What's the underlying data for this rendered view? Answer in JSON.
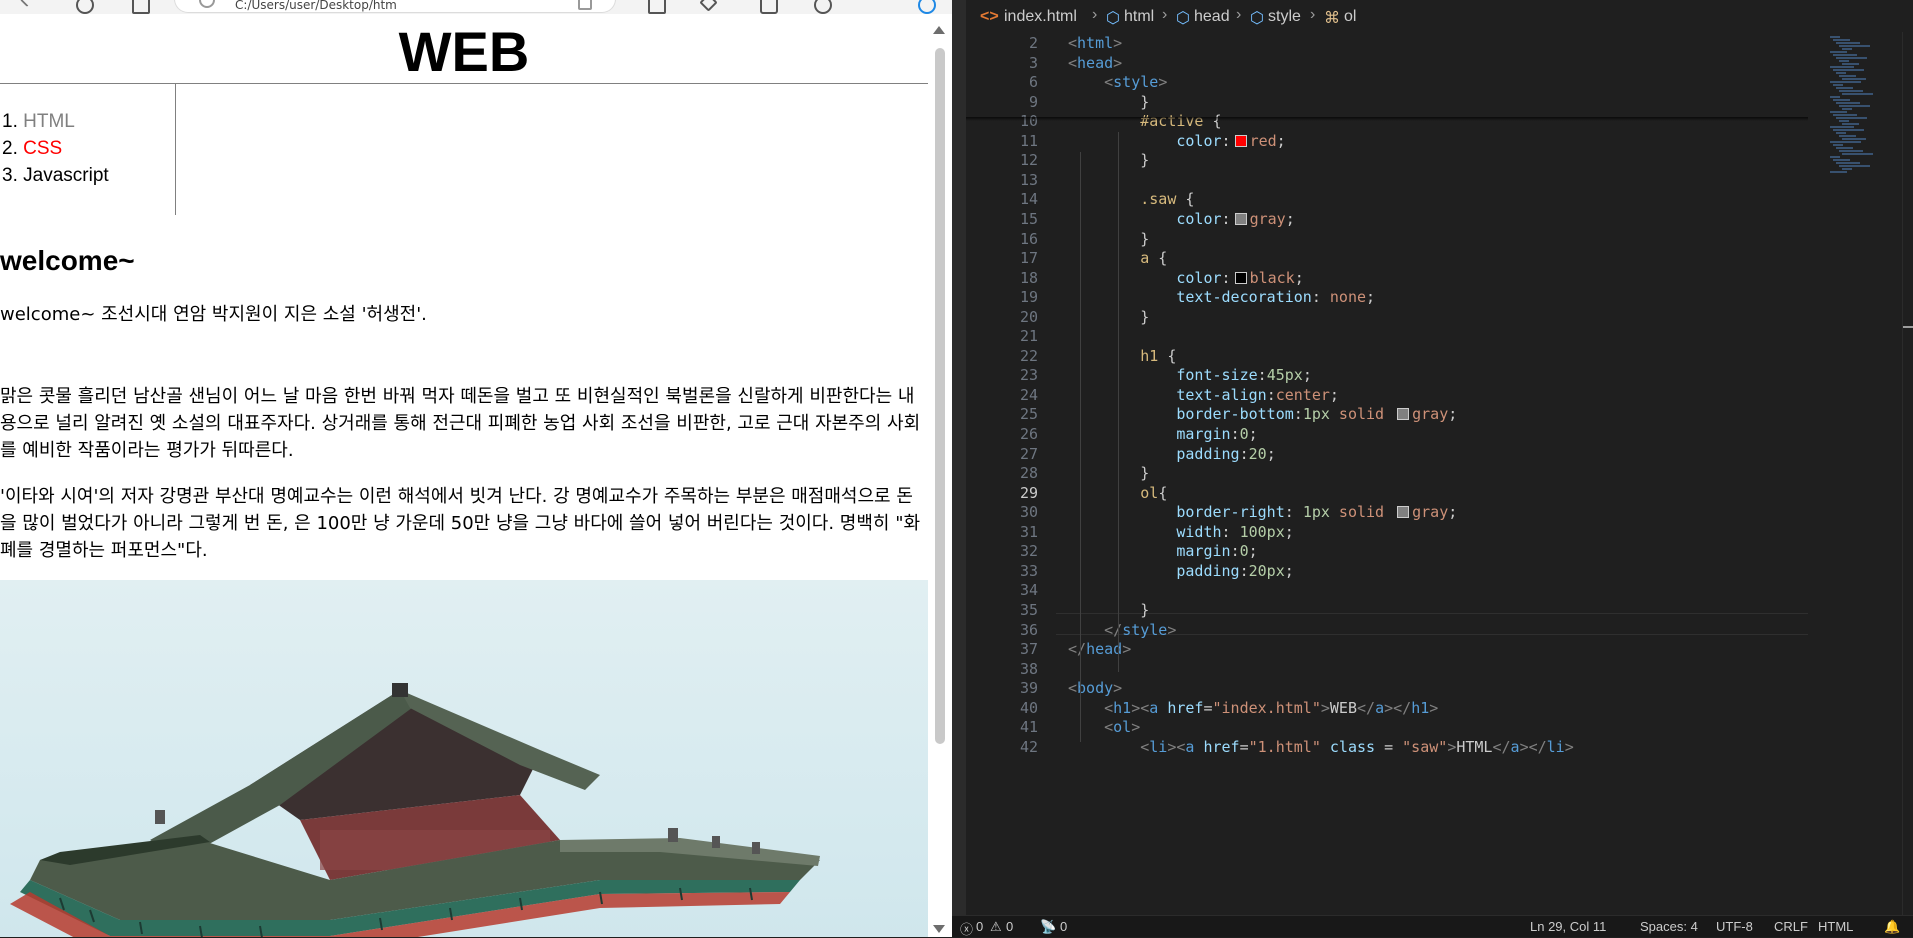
{
  "browser": {
    "address_text": "C:/Users/user/Desktop/htm",
    "page": {
      "title": "WEB",
      "nav": [
        {
          "num": "1.",
          "label": "HTML",
          "color": "#808080"
        },
        {
          "num": "2.",
          "label": "CSS",
          "color": "#ff0000"
        },
        {
          "num": "3.",
          "label": "Javascript",
          "color": "#000000"
        }
      ],
      "heading": "welcome~",
      "paragraphs": [
        "welcome~ 조선시대 연암 박지원이 지은 소설 '허생전'.",
        "맑은 콧물 흘리던 남산골 샌님이 어느 날 마음 한번 바꿔 먹자 떼돈을 벌고 또 비현실적인 북벌론을 신랄하게 비판한다는 내용으로 널리 알려진 옛 소설의 대표주자다. 상거래를 통해 전근대 피폐한 농업 사회 조선을 비판한, 고로 근대 자본주의 사회를 예비한 작품이라는 평가가 뒤따른다.",
        "'이타와 시여'의 저자 강명관 부산대 명예교수는 이런 해석에서 빗겨 난다. 강 명예교수가 주목하는 부분은 매점매석으로 돈을 많이 벌었다가 아니라 그렇게 번 돈, 은 100만 냥 가운데 50만 냥을 그냥 바다에 쓸어 넣어 버린다는 것이다. 명백히 \"화폐를 경멸하는 퍼포먼스\"다."
      ],
      "image_desc": "palace-roof-photo"
    }
  },
  "editor": {
    "breadcrumb": [
      "index.html",
      "html",
      "head",
      "style",
      "ol"
    ],
    "lines": [
      {
        "n": "2",
        "tokens": [
          [
            "tagbr",
            "<"
          ],
          [
            "tag",
            "html"
          ],
          [
            "tagbr",
            ">"
          ]
        ]
      },
      {
        "n": "3",
        "tokens": [
          [
            "tagbr",
            "<"
          ],
          [
            "tag",
            "head"
          ],
          [
            "tagbr",
            ">"
          ]
        ]
      },
      {
        "n": "6",
        "tokens": [
          [
            "punct",
            "    "
          ],
          [
            "tagbr",
            "<"
          ],
          [
            "tag",
            "style"
          ],
          [
            "tagbr",
            ">"
          ]
        ]
      },
      {
        "n": "9",
        "tokens": [
          [
            "punct",
            "        }"
          ]
        ]
      },
      {
        "n": "10",
        "tokens": [
          [
            "punct",
            "        "
          ],
          [
            "sel",
            "#active"
          ],
          [
            "punct",
            " {"
          ]
        ]
      },
      {
        "n": "11",
        "tokens": [
          [
            "punct",
            "            "
          ],
          [
            "prop",
            "color"
          ],
          [
            "punct",
            ":"
          ],
          [
            "sw:#ff0000",
            ""
          ],
          [
            "val",
            "red"
          ],
          [
            "punct",
            ";"
          ]
        ]
      },
      {
        "n": "12",
        "tokens": [
          [
            "punct",
            "        }"
          ]
        ]
      },
      {
        "n": "13",
        "tokens": []
      },
      {
        "n": "14",
        "tokens": [
          [
            "punct",
            "        "
          ],
          [
            "sel",
            ".saw"
          ],
          [
            "punct",
            " {"
          ]
        ]
      },
      {
        "n": "15",
        "tokens": [
          [
            "punct",
            "            "
          ],
          [
            "prop",
            "color"
          ],
          [
            "punct",
            ":"
          ],
          [
            "sw:#808080",
            ""
          ],
          [
            "val",
            "gray"
          ],
          [
            "punct",
            ";"
          ]
        ]
      },
      {
        "n": "16",
        "tokens": [
          [
            "punct",
            "        }"
          ]
        ]
      },
      {
        "n": "17",
        "tokens": [
          [
            "punct",
            "        "
          ],
          [
            "sel",
            "a"
          ],
          [
            "punct",
            " {"
          ]
        ]
      },
      {
        "n": "18",
        "tokens": [
          [
            "punct",
            "            "
          ],
          [
            "prop",
            "color"
          ],
          [
            "punct",
            ":"
          ],
          [
            "sw:#000000",
            ""
          ],
          [
            "val",
            "black"
          ],
          [
            "punct",
            ";"
          ]
        ]
      },
      {
        "n": "19",
        "tokens": [
          [
            "punct",
            "            "
          ],
          [
            "prop",
            "text-decoration"
          ],
          [
            "punct",
            ": "
          ],
          [
            "val",
            "none"
          ],
          [
            "punct",
            ";"
          ]
        ]
      },
      {
        "n": "20",
        "tokens": [
          [
            "punct",
            "        }"
          ]
        ]
      },
      {
        "n": "21",
        "tokens": []
      },
      {
        "n": "22",
        "tokens": [
          [
            "punct",
            "        "
          ],
          [
            "sel",
            "h1"
          ],
          [
            "punct",
            " {"
          ]
        ]
      },
      {
        "n": "23",
        "tokens": [
          [
            "punct",
            "            "
          ],
          [
            "prop",
            "font-size"
          ],
          [
            "punct",
            ":"
          ],
          [
            "num",
            "45px"
          ],
          [
            "punct",
            ";"
          ]
        ]
      },
      {
        "n": "24",
        "tokens": [
          [
            "punct",
            "            "
          ],
          [
            "prop",
            "text-align"
          ],
          [
            "punct",
            ":"
          ],
          [
            "val",
            "center"
          ],
          [
            "punct",
            ";"
          ]
        ]
      },
      {
        "n": "25",
        "tokens": [
          [
            "punct",
            "            "
          ],
          [
            "prop",
            "border-bottom"
          ],
          [
            "punct",
            ":"
          ],
          [
            "num",
            "1px"
          ],
          [
            "val",
            " solid "
          ],
          [
            "sw:#808080",
            ""
          ],
          [
            "val",
            "gray"
          ],
          [
            "punct",
            ";"
          ]
        ]
      },
      {
        "n": "26",
        "tokens": [
          [
            "punct",
            "            "
          ],
          [
            "prop",
            "margin"
          ],
          [
            "punct",
            ":"
          ],
          [
            "num",
            "0"
          ],
          [
            "punct",
            ";"
          ]
        ]
      },
      {
        "n": "27",
        "tokens": [
          [
            "punct",
            "            "
          ],
          [
            "prop",
            "padding"
          ],
          [
            "punct",
            ":"
          ],
          [
            "num",
            "20"
          ],
          [
            "punct",
            ";"
          ]
        ]
      },
      {
        "n": "28",
        "tokens": [
          [
            "punct",
            "        }"
          ]
        ]
      },
      {
        "n": "29",
        "tokens": [
          [
            "punct",
            "        "
          ],
          [
            "sel",
            "ol"
          ],
          [
            "punct",
            "{"
          ]
        ]
      },
      {
        "n": "30",
        "tokens": [
          [
            "punct",
            "            "
          ],
          [
            "prop",
            "border-right"
          ],
          [
            "punct",
            ": "
          ],
          [
            "num",
            "1px"
          ],
          [
            "val",
            " solid "
          ],
          [
            "sw:#808080",
            ""
          ],
          [
            "val",
            "gray"
          ],
          [
            "punct",
            ";"
          ]
        ]
      },
      {
        "n": "31",
        "tokens": [
          [
            "punct",
            "            "
          ],
          [
            "prop",
            "width"
          ],
          [
            "punct",
            ": "
          ],
          [
            "num",
            "100px"
          ],
          [
            "punct",
            ";"
          ]
        ]
      },
      {
        "n": "32",
        "tokens": [
          [
            "punct",
            "            "
          ],
          [
            "prop",
            "margin"
          ],
          [
            "punct",
            ":"
          ],
          [
            "num",
            "0"
          ],
          [
            "punct",
            ";"
          ]
        ]
      },
      {
        "n": "33",
        "tokens": [
          [
            "punct",
            "            "
          ],
          [
            "prop",
            "padding"
          ],
          [
            "punct",
            ":"
          ],
          [
            "num",
            "20px"
          ],
          [
            "punct",
            ";"
          ]
        ]
      },
      {
        "n": "34",
        "tokens": []
      },
      {
        "n": "35",
        "tokens": [
          [
            "punct",
            "        }"
          ]
        ]
      },
      {
        "n": "36",
        "tokens": [
          [
            "punct",
            "    "
          ],
          [
            "tagbr",
            "</"
          ],
          [
            "tag",
            "style"
          ],
          [
            "tagbr",
            ">"
          ]
        ]
      },
      {
        "n": "37",
        "tokens": [
          [
            "tagbr",
            "</"
          ],
          [
            "tag",
            "head"
          ],
          [
            "tagbr",
            ">"
          ]
        ]
      },
      {
        "n": "38",
        "tokens": []
      },
      {
        "n": "39",
        "tokens": [
          [
            "tagbr",
            "<"
          ],
          [
            "tag",
            "body"
          ],
          [
            "tagbr",
            ">"
          ]
        ]
      },
      {
        "n": "40",
        "tokens": [
          [
            "punct",
            "    "
          ],
          [
            "tagbr",
            "<"
          ],
          [
            "tag",
            "h1"
          ],
          [
            "tagbr",
            "><"
          ],
          [
            "tag",
            "a"
          ],
          [
            "punct",
            " "
          ],
          [
            "attr",
            "href"
          ],
          [
            "punct",
            "="
          ],
          [
            "str",
            "\"index.html\""
          ],
          [
            "tagbr",
            ">"
          ],
          [
            "punct",
            "WEB"
          ],
          [
            "tagbr",
            "</"
          ],
          [
            "tag",
            "a"
          ],
          [
            "tagbr",
            "></"
          ],
          [
            "tag",
            "h1"
          ],
          [
            "tagbr",
            ">"
          ]
        ]
      },
      {
        "n": "41",
        "tokens": [
          [
            "punct",
            "    "
          ],
          [
            "tagbr",
            "<"
          ],
          [
            "tag",
            "ol"
          ],
          [
            "tagbr",
            ">"
          ]
        ]
      },
      {
        "n": "42",
        "tokens": [
          [
            "punct",
            "        "
          ],
          [
            "tagbr",
            "<"
          ],
          [
            "tag",
            "li"
          ],
          [
            "tagbr",
            "><"
          ],
          [
            "tag",
            "a"
          ],
          [
            "punct",
            " "
          ],
          [
            "attr",
            "href"
          ],
          [
            "punct",
            "="
          ],
          [
            "str",
            "\"1.html\""
          ],
          [
            "punct",
            " "
          ],
          [
            "attr",
            "class"
          ],
          [
            "punct",
            " = "
          ],
          [
            "str",
            "\"saw\""
          ],
          [
            "tagbr",
            ">"
          ],
          [
            "punct",
            "HTML"
          ],
          [
            "tagbr",
            "</"
          ],
          [
            "tag",
            "a"
          ],
          [
            "tagbr",
            "></"
          ],
          [
            "tag",
            "li"
          ],
          [
            "tagbr",
            ">"
          ]
        ]
      }
    ],
    "current_line": "29",
    "status": {
      "errors": "0",
      "warnings": "0",
      "ports": "0",
      "position": "Ln 29, Col 11",
      "spaces": "Spaces: 4",
      "encoding": "UTF-8",
      "eol": "CRLF",
      "language": "HTML"
    }
  }
}
